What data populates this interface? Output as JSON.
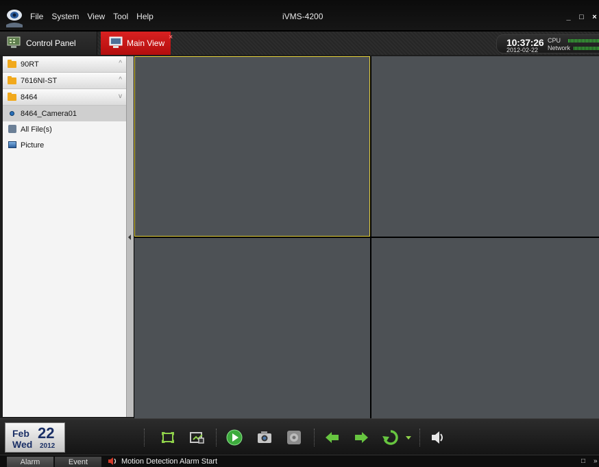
{
  "app": {
    "title": "iVMS-4200"
  },
  "menu": {
    "items": [
      "File",
      "System",
      "View",
      "Tool",
      "Help"
    ]
  },
  "window_buttons": {
    "minimize": "_",
    "maximize": "□",
    "close": "×"
  },
  "tabs": [
    {
      "label": "Control Panel",
      "active": false
    },
    {
      "label": "Main View",
      "active": true,
      "close": "×"
    }
  ],
  "status_clock": {
    "time": "10:37:26",
    "date": "2012-02-22",
    "cpu_label": "CPU",
    "network_label": "Network"
  },
  "device_tree": {
    "groups": [
      {
        "label": "90RT",
        "chevron": "^"
      },
      {
        "label": "7616NI-ST",
        "chevron": "^"
      },
      {
        "label": "8464",
        "chevron": "v"
      }
    ],
    "items": [
      {
        "label": "8464_Camera01",
        "icon": "camera-icon",
        "selected": true
      },
      {
        "label": "All File(s)",
        "icon": "files-icon",
        "selected": false
      },
      {
        "label": "Picture",
        "icon": "picture-icon",
        "selected": false
      }
    ]
  },
  "date_widget": {
    "month": "Feb",
    "day": "22",
    "weekday": "Wed",
    "year": "2012"
  },
  "toolbar": {
    "buttons": [
      "fullscreen-icon",
      "window-layout-icon",
      "play-icon",
      "snapshot-icon",
      "record-icon",
      "previous-icon",
      "next-icon",
      "cycle-icon",
      "cycle-dropdown-icon",
      "volume-icon"
    ]
  },
  "statusbar": {
    "alarm_tab": "Alarm",
    "event_tab": "Event",
    "message": "Motion Detection Alarm  Start",
    "restore": "□",
    "collapse": "»"
  },
  "colors": {
    "accent_red": "#c41414",
    "active_border": "#e6d23a",
    "video_cell": "#4d5155",
    "meter_green": "#3bd13b"
  }
}
